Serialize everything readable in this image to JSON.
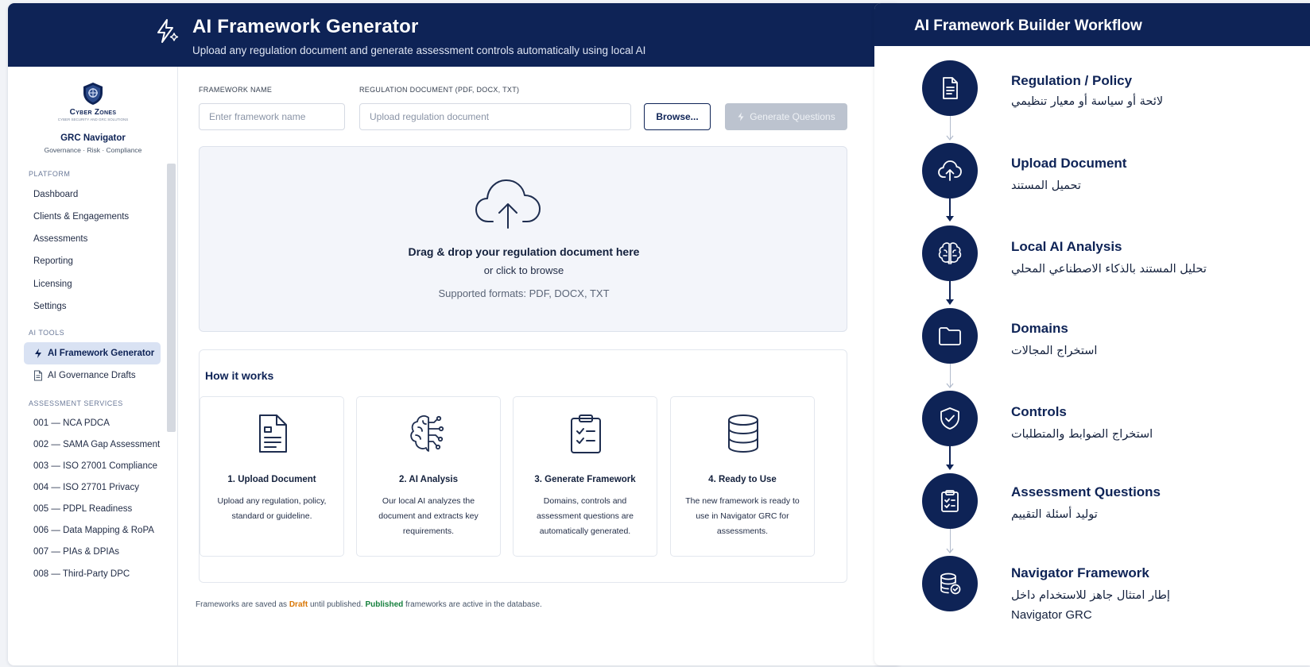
{
  "header": {
    "title": "AI Framework Generator",
    "subtitle": "Upload any regulation document and generate assessment controls automatically using local AI"
  },
  "sidebar": {
    "logo_text": "Cyber Zones",
    "logo_tagline": "CYBER SECURITY AND GRC SOLUTIONS",
    "brand_name": "GRC Navigator",
    "brand_tagline": "Governance · Risk · Compliance",
    "platform_label": "PLATFORM",
    "platform_items": [
      "Dashboard",
      "Clients & Engagements",
      "Assessments",
      "Reporting",
      "Licensing",
      "Settings"
    ],
    "ai_tools_label": "AI TOOLS",
    "ai_tools_items": [
      "AI Framework Generator",
      "AI Governance Drafts"
    ],
    "services_label": "ASSESSMENT SERVICES",
    "services_items": [
      "001 — NCA PDCA",
      "002 — SAMA Gap Assessment",
      "003 — ISO 27001 Compliance",
      "004 — ISO 27701 Privacy",
      "005 — PDPL Readiness",
      "006 — Data Mapping & RoPA",
      "007 — PIAs & DPIAs",
      "008 — Third-Party DPC"
    ]
  },
  "form": {
    "name_label": "FRAMEWORK NAME",
    "name_placeholder": "Enter framework name",
    "doc_label": "REGULATION DOCUMENT (PDF, DOCX, TXT)",
    "doc_placeholder": "Upload regulation document",
    "browse_label": "Browse...",
    "generate_label": "Generate Questions"
  },
  "dropzone": {
    "title": "Drag & drop your regulation document here",
    "or": "or click to browse",
    "formats": "Supported formats: PDF, DOCX, TXT"
  },
  "how": {
    "title": "How it works",
    "steps": [
      {
        "title": "1. Upload Document",
        "desc": "Upload any regulation, policy, standard or guideline.",
        "icon": "document-icon"
      },
      {
        "title": "2. AI Analysis",
        "desc": "Our local AI analyzes the document and extracts key requirements.",
        "icon": "brain-icon"
      },
      {
        "title": "3. Generate Framework",
        "desc": "Domains, controls and assessment questions are automatically generated.",
        "icon": "clipboard-icon"
      },
      {
        "title": "4. Ready to Use",
        "desc": "The new framework is ready to use in Navigator GRC for assessments.",
        "icon": "database-icon"
      }
    ]
  },
  "footer": {
    "prefix": "Frameworks are saved as",
    "draft": "Draft",
    "middle": "until published.",
    "published": "Published",
    "suffix": "frameworks are active in the database."
  },
  "workflow": {
    "title": "AI Framework Builder Workflow",
    "steps": [
      {
        "title": "Regulation / Policy",
        "ar": "لائحة أو سياسة أو معيار تنظيمي",
        "icon": "document-icon"
      },
      {
        "title": "Upload Document",
        "ar": "تحميل المستند",
        "icon": "cloud-upload-icon"
      },
      {
        "title": "Local AI Analysis",
        "ar": "تحليل المستند بالذكاء الاصطناعي المحلي",
        "icon": "brain-icon"
      },
      {
        "title": "Domains",
        "ar": "استخراج المجالات",
        "icon": "folder-icon"
      },
      {
        "title": "Controls",
        "ar": "استخراج الضوابط والمتطلبات",
        "icon": "shield-check-icon"
      },
      {
        "title": "Assessment Questions",
        "ar": "توليد أسئلة التقييم",
        "icon": "clipboard-icon"
      },
      {
        "title": "Navigator Framework",
        "ar": "إطار امتثال جاهز للاستخدام داخل",
        "extra": "Navigator GRC",
        "icon": "database-check-icon"
      }
    ]
  },
  "colors": {
    "navy": "#0e2356",
    "draft": "#d97706",
    "published": "#15803d",
    "active_nav_bg": "#d9e2f3"
  }
}
